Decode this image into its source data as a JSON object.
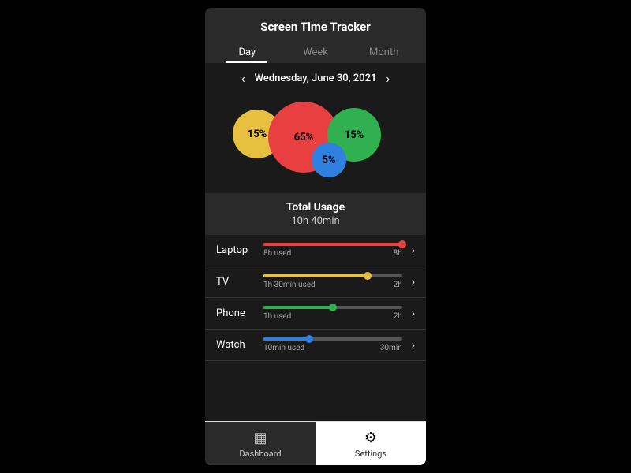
{
  "header": {
    "title": "Screen Time Tracker"
  },
  "tabs": [
    {
      "id": "day",
      "label": "Day",
      "active": true
    },
    {
      "id": "week",
      "label": "Week",
      "active": false
    },
    {
      "id": "month",
      "label": "Month",
      "active": false
    }
  ],
  "date_nav": {
    "date": "Wednesday, June 30, 2021",
    "prev_arrow": "‹",
    "next_arrow": "›"
  },
  "bubbles": [
    {
      "id": "yellow",
      "label": "15%",
      "color": "#e8c040"
    },
    {
      "id": "red",
      "label": "65%",
      "color": "#e84040"
    },
    {
      "id": "green",
      "label": "15%",
      "color": "#30b050"
    },
    {
      "id": "blue",
      "label": "5%",
      "color": "#3080e0"
    }
  ],
  "total_usage": {
    "label": "Total Usage",
    "value": "10h 40min"
  },
  "devices": [
    {
      "name": "Laptop",
      "used_text": "8h used",
      "limit_text": "8h",
      "fill_pct": 100,
      "bar_color": "#e84040",
      "dot_color": "#e84040"
    },
    {
      "name": "TV",
      "used_text": "1h 30min used",
      "limit_text": "2h",
      "fill_pct": 75,
      "bar_color": "#e8c040",
      "dot_color": "#e8c040"
    },
    {
      "name": "Phone",
      "used_text": "1h used",
      "limit_text": "2h",
      "fill_pct": 50,
      "bar_color": "#30b050",
      "dot_color": "#30b050"
    },
    {
      "name": "Watch",
      "used_text": "10min used",
      "limit_text": "30min",
      "fill_pct": 33,
      "bar_color": "#3080e0",
      "dot_color": "#3080e0"
    }
  ],
  "bottom_nav": [
    {
      "id": "dashboard",
      "label": "Dashboard",
      "icon": "▦",
      "active": false
    },
    {
      "id": "settings",
      "label": "Settings",
      "icon": "⚙",
      "active": true
    }
  ]
}
